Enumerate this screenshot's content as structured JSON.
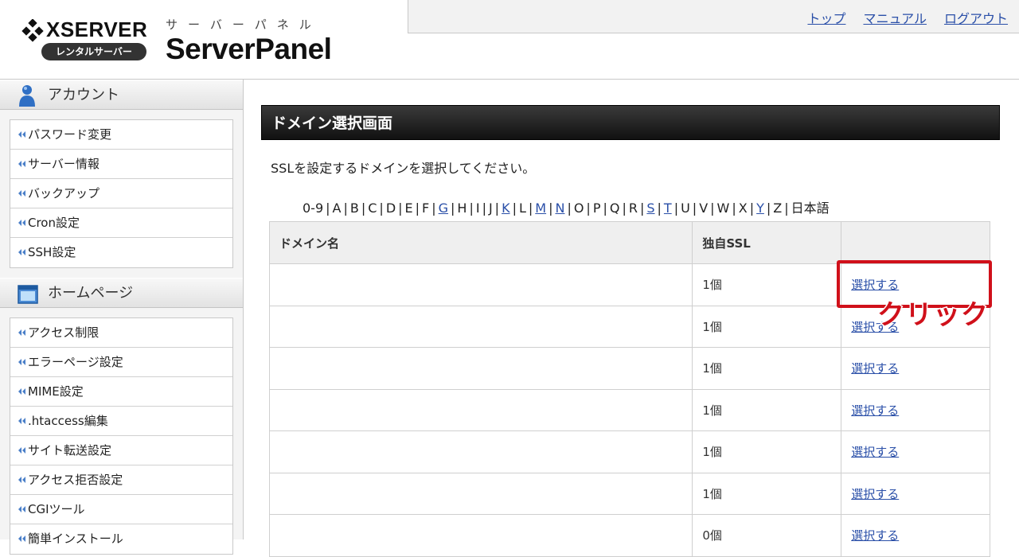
{
  "header": {
    "brand": "XSERVER",
    "brand_sub": "レンタルサーバー",
    "panel_kana": "サーバーパネル",
    "panel_name": "ServerPanel",
    "nav": [
      {
        "label": "トップ"
      },
      {
        "label": "マニュアル"
      },
      {
        "label": "ログアウト"
      }
    ]
  },
  "sidebar": {
    "sections": [
      {
        "title": "アカウント",
        "icon": "user-icon",
        "items": [
          {
            "label": "パスワード変更"
          },
          {
            "label": "サーバー情報"
          },
          {
            "label": "バックアップ"
          },
          {
            "label": "Cron設定"
          },
          {
            "label": "SSH設定"
          }
        ]
      },
      {
        "title": "ホームページ",
        "icon": "window-icon",
        "items": [
          {
            "label": "アクセス制限"
          },
          {
            "label": "エラーページ設定"
          },
          {
            "label": "MIME設定"
          },
          {
            "label": ".htaccess編集"
          },
          {
            "label": "サイト転送設定"
          },
          {
            "label": "アクセス拒否設定"
          },
          {
            "label": "CGIツール"
          },
          {
            "label": "簡単インストール"
          }
        ]
      }
    ]
  },
  "main": {
    "title": "ドメイン選択画面",
    "description": "SSLを設定するドメインを選択してください。",
    "index": [
      {
        "label": "0-9",
        "link": false
      },
      {
        "label": "A",
        "link": false
      },
      {
        "label": "B",
        "link": false
      },
      {
        "label": "C",
        "link": false
      },
      {
        "label": "D",
        "link": false
      },
      {
        "label": "E",
        "link": false
      },
      {
        "label": "F",
        "link": false
      },
      {
        "label": "G",
        "link": true
      },
      {
        "label": "H",
        "link": false
      },
      {
        "label": "I",
        "link": false
      },
      {
        "label": "J",
        "link": false
      },
      {
        "label": "K",
        "link": true
      },
      {
        "label": "L",
        "link": false
      },
      {
        "label": "M",
        "link": true
      },
      {
        "label": "N",
        "link": true
      },
      {
        "label": "O",
        "link": false
      },
      {
        "label": "P",
        "link": false
      },
      {
        "label": "Q",
        "link": false
      },
      {
        "label": "R",
        "link": false
      },
      {
        "label": "S",
        "link": true
      },
      {
        "label": "T",
        "link": true
      },
      {
        "label": "U",
        "link": false
      },
      {
        "label": "V",
        "link": false
      },
      {
        "label": "W",
        "link": false
      },
      {
        "label": "X",
        "link": false
      },
      {
        "label": "Y",
        "link": true
      },
      {
        "label": "Z",
        "link": false
      },
      {
        "label": "日本語",
        "link": false
      }
    ],
    "table": {
      "headers": [
        "ドメイン名",
        "独自SSL",
        ""
      ],
      "rows": [
        {
          "domain": "",
          "ssl": "1個",
          "action": "選択する"
        },
        {
          "domain": "",
          "ssl": "1個",
          "action": "選択する"
        },
        {
          "domain": "",
          "ssl": "1個",
          "action": "選択する"
        },
        {
          "domain": "",
          "ssl": "1個",
          "action": "選択する"
        },
        {
          "domain": "",
          "ssl": "1個",
          "action": "選択する"
        },
        {
          "domain": "",
          "ssl": "1個",
          "action": "選択する"
        },
        {
          "domain": "",
          "ssl": "0個",
          "action": "選択する"
        }
      ]
    },
    "annotation": "クリック"
  },
  "colors": {
    "link": "#2a4fa8",
    "annotation": "#d0101a",
    "title_bar": "#1a1a1a"
  }
}
